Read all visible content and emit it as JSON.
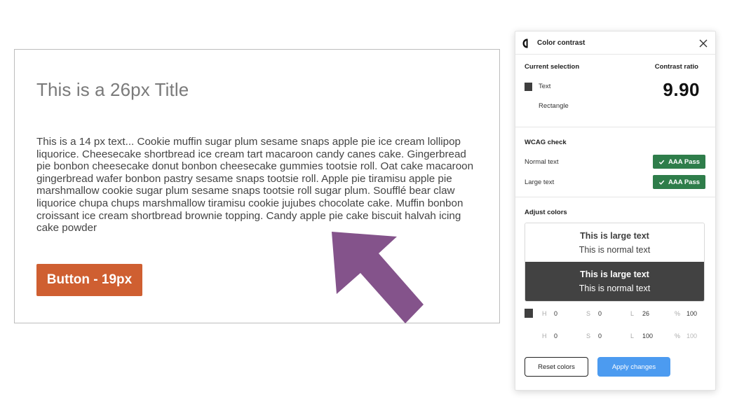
{
  "canvas": {
    "title": "This is a 26px Title",
    "body": "This is a 14 px text... Cookie muffin sugar plum sesame snaps apple pie ice cream lollipop liquorice. Cheesecake shortbread ice cream tart macaroon candy canes cake. Gingerbread pie bonbon cheesecake donut bonbon cheesecake gummies tootsie roll. Oat cake macaroon gingerbread wafer bonbon pastry sesame snaps tootsie roll. Apple pie tiramisu apple pie marshmallow cookie sugar plum sesame snaps tootsie roll sugar plum. Soufflé bear claw liquorice chupa chups marshmallow tiramisu cookie jujubes chocolate cake. Muffin bonbon croissant ice cream shortbread brownie topping. Candy apple pie cake biscuit halvah icing cake powder",
    "button_label": "Button - 19px",
    "button_color": "#cf5f31",
    "arrow_color": "#84538b"
  },
  "panel": {
    "title": "Color contrast",
    "current_selection_label": "Current selection",
    "contrast_ratio_label": "Contrast ratio",
    "contrast_ratio": "9.90",
    "selection": {
      "text_label": "Text",
      "rectangle_label": "Rectangle",
      "text_color": "#3f3f3f"
    },
    "wcag": {
      "heading": "WCAG check",
      "normal_label": "Normal text",
      "normal_result": "AAA Pass",
      "large_label": "Large text",
      "large_result": "AAA Pass",
      "pass_color": "#2e7d4a"
    },
    "adjust": {
      "heading": "Adjust colors",
      "preview_large": "This is large text",
      "preview_normal": "This is normal text",
      "preview_large_dark": "This is large text",
      "preview_normal_dark": "This is normal text",
      "text_hsl": {
        "h_label": "H",
        "h": "0",
        "s_label": "S",
        "s": "0",
        "l_label": "L",
        "l": "26",
        "pct_label": "%",
        "alpha": "100"
      },
      "rect_hsl": {
        "h_label": "H",
        "h": "0",
        "s_label": "S",
        "s": "0",
        "l_label": "L",
        "l": "100",
        "pct_label": "%",
        "alpha": "100"
      }
    },
    "reset_label": "Reset colors",
    "apply_label": "Apply changes",
    "apply_color": "#4c9bf0"
  }
}
